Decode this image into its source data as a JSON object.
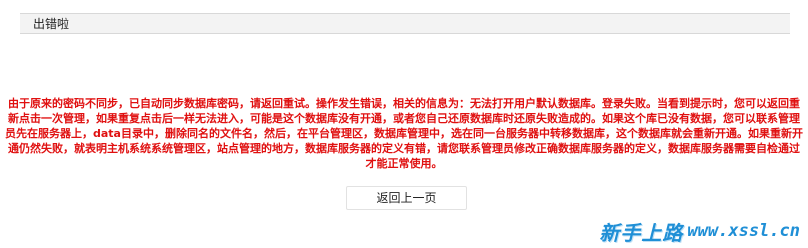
{
  "header": {
    "title": "出错啦"
  },
  "error": {
    "message": "由于原来的密码不同步，已自动同步数据库密码，请返回重试。操作发生错误，相关的信息为：无法打开用户默认数据库。登录失败。当看到提示时，您可以返回重新点击一次管理，如果重复点击后一样无法进入，可能是这个数据库没有开通，或者您自己还原数据库时还原失败造成的。如果这个库已没有数据，您可以联系管理员先在服务器上，data目录中，删除同名的文件名，然后，在平台管理区，数据库管理中，选在同一台服务器中转移数据库，这个数据库就会重新开通。如果重新开通仍然失败，就表明主机系统系统管理区，站点管理的地方，数据库服务器的定义有错，请您联系管理员修改正确数据库服务器的定义，数据库服务器需要自检通过才能正常使用。"
  },
  "actions": {
    "back_label": "返回上一页"
  },
  "watermark": {
    "logo_text": "新手上路",
    "site_text": "www.xssl.cn"
  }
}
